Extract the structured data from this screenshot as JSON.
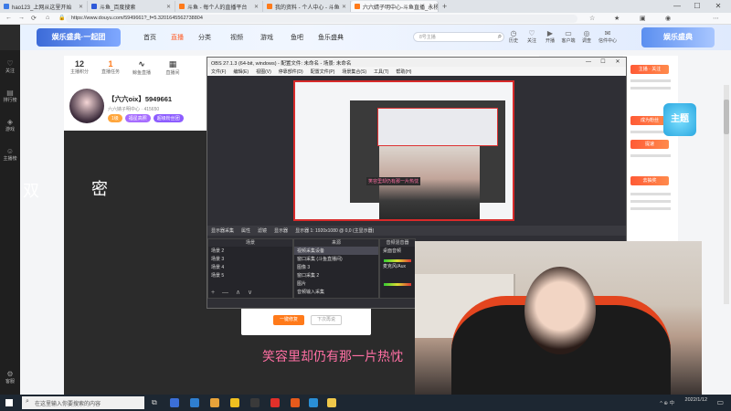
{
  "browser": {
    "tabs": [
      {
        "label": "hao123_上网从这里开始",
        "color": "#3d7be6",
        "active": false
      },
      {
        "label": "斗鱼_百度搜索",
        "color": "#2f5ad9",
        "active": false
      },
      {
        "label": "斗鱼 - 每个人的直播平台",
        "color": "#ff7a1a",
        "active": false
      },
      {
        "label": "我的资料 - 个人中心 - 斗鱼",
        "color": "#ff7a1a",
        "active": false
      },
      {
        "label": "六六婧子明中心-斗鱼直播_永杨恩调进",
        "color": "#ff7a1a",
        "active": true
      }
    ],
    "new_tab": "+",
    "window_controls": [
      "—",
      "☐",
      "✕"
    ],
    "url": "https://www.douyu.com/5949661?_f=5.3201645562738804"
  },
  "header": {
    "logo_text": "娱乐盛典·一起团",
    "nav": [
      "首页",
      "直播",
      "分类",
      "视频",
      "游戏",
      "鱼吧",
      "鱼乐盛典"
    ],
    "active_nav": "直播",
    "search_placeholder": "8号主播",
    "icons": [
      {
        "name": "history-icon",
        "label": "历史"
      },
      {
        "name": "follow-icon",
        "label": "关注"
      },
      {
        "name": "live-icon",
        "label": "开播"
      },
      {
        "name": "client-icon",
        "label": "客户端"
      },
      {
        "name": "recharge-icon",
        "label": "调查"
      },
      {
        "name": "message-icon",
        "label": "信件中心"
      }
    ],
    "banner_right": "娱乐盛典"
  },
  "sidebar": {
    "items": [
      {
        "icon": "heart-icon",
        "label": "关注"
      },
      {
        "icon": "rank-icon",
        "label": "排行榜"
      },
      {
        "icon": "game-icon",
        "label": "游戏"
      },
      {
        "icon": "fan-icon",
        "label": "主播榜"
      },
      {
        "icon": "settings-icon",
        "label": "客服"
      }
    ]
  },
  "anchor": {
    "stats": [
      {
        "value": "12",
        "label": "主播积分"
      },
      {
        "value": "1",
        "label": "直播任务"
      },
      {
        "value": "",
        "label": "鲸鱼直播"
      },
      {
        "value": "",
        "label": "直播间"
      }
    ],
    "room_title": "【六六oix】5949661",
    "room_sub": "六六婧子明中心 · 415650",
    "tags": [
      {
        "text": "1级",
        "color": "#ffa63c"
      },
      {
        "text": "福星高照",
        "color": "#a66cff"
      },
      {
        "text": "超级粉丝团",
        "color": "#8c5cff"
      }
    ]
  },
  "video": {
    "danmaku_1": "双",
    "danmaku_2": "密",
    "subtitle": "笑容里却仍有那一片热忱",
    "dialog": {
      "ok": "一键修复",
      "cancel": "下次再说"
    }
  },
  "right_rail": {
    "buttons": [
      "主播 · 关注",
      "成为粉丝",
      "提速",
      "去抽奖"
    ],
    "gift_badge": "主题"
  },
  "obs": {
    "title": "OBS 27.1.3 (64-bit, windows) - 配置文件: 未命名 - 场景: 未命名",
    "menu": [
      "文件(F)",
      "编辑(E)",
      "视图(V)",
      "停靠部件(D)",
      "配置文件(P)",
      "场景集合(S)",
      "工具(T)",
      "帮助(H)"
    ],
    "toolbar": [
      "显示器采集",
      "属性",
      "滤镜",
      "显示器",
      "显示器 1: 1920x1080 @ 0,0 (主显示器)"
    ],
    "nested_caption": "笑容里却仍有那一片热忱",
    "scenes_header": "场景",
    "scenes": [
      "场景 2",
      "场景 3",
      "场景 4",
      "场景 5"
    ],
    "sources_header": "来源",
    "sources": [
      "视频采集设备",
      "窗口采集 (斗鱼直播间)",
      "图像 3",
      "窗口采集 2",
      "图片",
      "音频输入采集"
    ],
    "mixer_header": "音频混音器",
    "mixer_labels": [
      "桌面音频",
      "麦克风/Aux"
    ],
    "dock_controls": "+ — ∧ ∨"
  },
  "taskbar": {
    "search_placeholder": "在这里输入你要搜索的内容",
    "clock_time": "",
    "clock_date": "2022/1/12",
    "tray": "^  ⊕  中",
    "apps": [
      "#3b6fd8",
      "#2f7fd0",
      "#e8a33a",
      "#f0c020",
      "#3a3a3a",
      "#e0302a",
      "#e55a1c",
      "#2a8fd6",
      "#f0c84a"
    ]
  }
}
